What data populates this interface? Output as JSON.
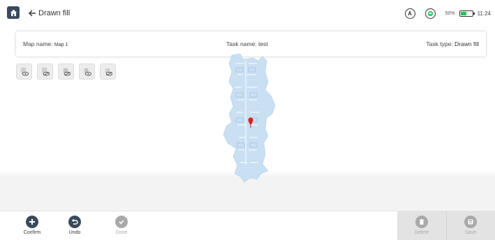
{
  "header": {
    "back_title": "Drawn fill",
    "mode_letter": "A",
    "battery_percent_text": "50%",
    "battery_level": 0.5,
    "time": "11:24"
  },
  "info": {
    "map_name_label": "Map name:",
    "map_name_value": "Map 1",
    "task_name_label": "Task name:",
    "task_name_value": "test",
    "task_type_label": "Task type:",
    "task_type_value": "Drawn fill"
  },
  "actions": {
    "confirm": "Confirm",
    "undo": "Undo",
    "done": "Done",
    "delete": "Delete",
    "save": "Save"
  },
  "colors": {
    "home_button": "#3a4a5c",
    "active_action": "#3a4a5c",
    "disabled_action": "#a9a9a9",
    "map_fill": "#c9dff2",
    "marker": "#e02020",
    "battery": "#23c25a"
  },
  "icons": {
    "home": "home-icon",
    "back": "arrow-left-icon",
    "mode": "circle-a-icon",
    "robot": "robot-status-icon",
    "confirm": "plus-icon",
    "undo": "undo-icon",
    "done": "check-icon",
    "delete": "trash-icon",
    "save": "save-icon"
  }
}
